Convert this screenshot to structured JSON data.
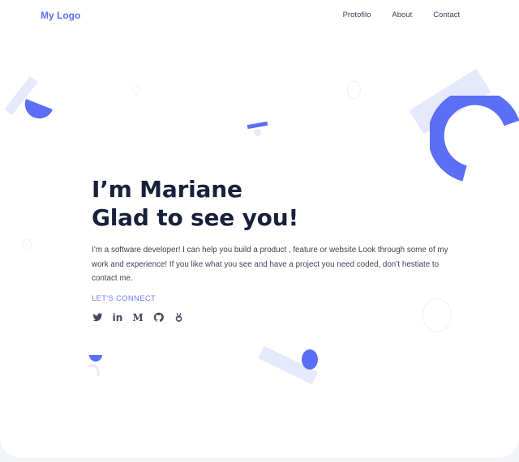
{
  "header": {
    "logo": "My Logo",
    "nav": [
      "Protofilo",
      "About",
      "Contact"
    ]
  },
  "hero": {
    "title_line1": "I’m Mariane",
    "title_line2": "Glad to see you!",
    "description": "I’m a software developer! I can help you build a product , feature or website Look through some of my work and experience! If you like what you see and have a project you need coded, don’t hestiate to contact me.",
    "cta_label": "LET'S CONNECT"
  },
  "socials": [
    {
      "icon": "twitter-icon"
    },
    {
      "icon": "linkedin-icon",
      "glyph": "in"
    },
    {
      "icon": "medium-icon",
      "glyph": "M"
    },
    {
      "icon": "github-icon"
    },
    {
      "icon": "codepen-icon"
    }
  ],
  "colors": {
    "accent": "#5b6ff6",
    "title": "#17213a",
    "decor": "#e6e8fb"
  }
}
